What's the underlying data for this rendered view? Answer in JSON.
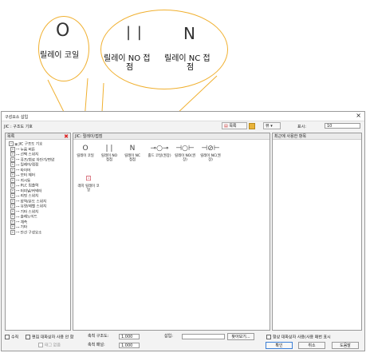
{
  "callouts": {
    "coil_symbol": "O",
    "coil_label": "릴레이 코일",
    "no_symbol": "| |",
    "no_label_1": "릴레이 NO 접",
    "no_label_2": "점",
    "nc_symbol": "N",
    "nc_label_1": "릴레이 NC 접",
    "nc_label_2": "점"
  },
  "dialog": {
    "title": "구성요소 삽입",
    "section": "JIC : 구조도 기호",
    "toolbar": {
      "view_label": "목록",
      "grid_label": "뷰",
      "display_label": "표시:",
      "display_value": "10"
    },
    "left_panel": {
      "header": "목록",
      "items": [
        {
          "label": "JIC 구조도 기호",
          "pm": "⊟"
        },
        {
          "label": "누름 버튼",
          "pm": "⊞"
        },
        {
          "label": "선택 스위치",
          "pm": "⊞"
        },
        {
          "label": "퓨즈/회로 차단기/변압",
          "pm": "⊞"
        },
        {
          "label": "릴레이/접점",
          "pm": "⊞"
        },
        {
          "label": "타이머",
          "pm": "⊞"
        },
        {
          "label": "모터 제어",
          "pm": "⊞"
        },
        {
          "label": "지시등",
          "pm": "⊞"
        },
        {
          "label": "PLC 입출력",
          "pm": "⊞"
        },
        {
          "label": "터미널/커넥터",
          "pm": "⊞"
        },
        {
          "label": "리밋 스위치",
          "pm": "⊞"
        },
        {
          "label": "압력/온도 스위치",
          "pm": "⊞"
        },
        {
          "label": "유량/레벨 스위치",
          "pm": "⊞"
        },
        {
          "label": "기타 스위치",
          "pm": "⊞"
        },
        {
          "label": "솔레노이드",
          "pm": "⊞"
        },
        {
          "label": "계측",
          "pm": "⊞"
        },
        {
          "label": "기타",
          "pm": "⊞"
        },
        {
          "label": "단선 구성요소",
          "pm": "⊞"
        }
      ]
    },
    "mid_panel": {
      "header": "JIC: 릴레이/접점",
      "symbols": [
        {
          "glyph": "O",
          "label": "릴레이 코일"
        },
        {
          "glyph": "| |",
          "label": "릴레이 NO 접점"
        },
        {
          "glyph": "N",
          "label": "릴레이 NC 접점"
        },
        {
          "glyph": "⊸○⊸",
          "label": "홀드 코일(권장)"
        },
        {
          "glyph": "⊣○⊢",
          "label": "릴레이 NO(권장)"
        },
        {
          "glyph": "⊣⊘⊢",
          "label": "릴레이 NC(권장)"
        },
        {
          "glyph": "⊡",
          "label": "래치 릴레이 코일"
        }
      ]
    },
    "right_panel": {
      "header": "최근에 사용한 항목"
    },
    "bottom": {
      "vertical_label": "수직",
      "no_edit_label": "편집 대화상자 사용 안 함",
      "no_tag_label": "태그 없음",
      "x_scale_label": "축척 구조도:",
      "x_scale_value": "1.000",
      "y_scale_label": "축척 패널:",
      "y_scale_value": "1.000",
      "insert_label": "삽입:",
      "insert_value": "",
      "browse_label": "찾아보기...",
      "always_label": "항상 대화상자 사용(사용 매번 표시",
      "ok_label": "확인",
      "cancel_label": "취소",
      "help_label": "도움말"
    }
  }
}
